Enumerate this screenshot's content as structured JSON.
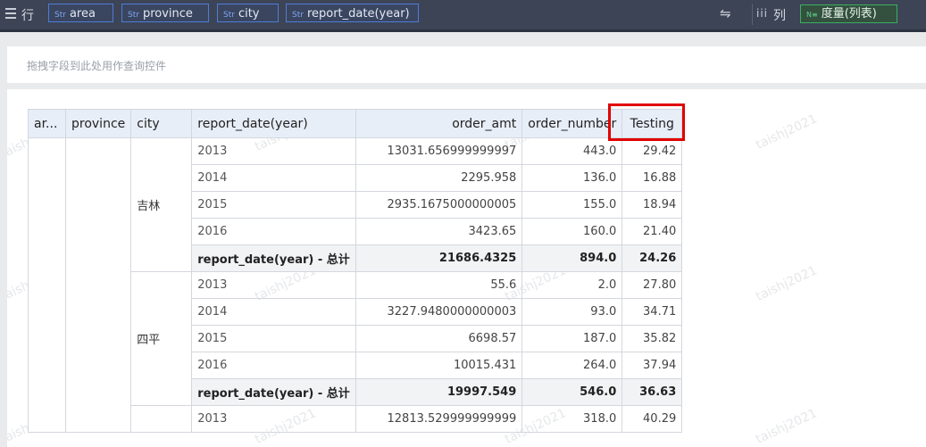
{
  "toolbar": {
    "rows_label": "行",
    "row_fields": [
      {
        "type": "Str",
        "name": "area"
      },
      {
        "type": "Str",
        "name": "province"
      },
      {
        "type": "Str",
        "name": "city"
      },
      {
        "type": "Str",
        "name": "report_date(year)"
      }
    ],
    "swap_icon": "⇋",
    "cols_icon": "iii",
    "cols_label": "列",
    "measure_field": {
      "type": "N≡",
      "name": "度量(列表)"
    }
  },
  "filter": {
    "placeholder": "拖拽字段到此处用作查询控件"
  },
  "watermark": "taishj2021",
  "table": {
    "headers": {
      "area": "ar...",
      "province": "province",
      "city": "city",
      "report_date": "report_date(year)",
      "order_amt": "order_amt",
      "order_number": "order_number",
      "testing": "Testing"
    },
    "groups": [
      {
        "city": "吉林",
        "rows": [
          {
            "year": "2013",
            "order_amt": "13031.656999999997",
            "order_number": "443.0",
            "testing": "29.42"
          },
          {
            "year": "2014",
            "order_amt": "2295.958",
            "order_number": "136.0",
            "testing": "16.88"
          },
          {
            "year": "2015",
            "order_amt": "2935.1675000000005",
            "order_number": "155.0",
            "testing": "18.94"
          },
          {
            "year": "2016",
            "order_amt": "3423.65",
            "order_number": "160.0",
            "testing": "21.40"
          }
        ],
        "subtotal": {
          "label": "report_date(year) - 总计",
          "order_amt": "21686.4325",
          "order_number": "894.0",
          "testing": "24.26"
        }
      },
      {
        "city": "四平",
        "rows": [
          {
            "year": "2013",
            "order_amt": "55.6",
            "order_number": "2.0",
            "testing": "27.80"
          },
          {
            "year": "2014",
            "order_amt": "3227.9480000000003",
            "order_number": "93.0",
            "testing": "34.71"
          },
          {
            "year": "2015",
            "order_amt": "6698.57",
            "order_number": "187.0",
            "testing": "35.82"
          },
          {
            "year": "2016",
            "order_amt": "10015.431",
            "order_number": "264.0",
            "testing": "37.94"
          }
        ],
        "subtotal": {
          "label": "report_date(year) - 总计",
          "order_amt": "19997.549",
          "order_number": "546.0",
          "testing": "36.63"
        }
      },
      {
        "city": "",
        "rows": [
          {
            "year": "2013",
            "order_amt": "12813.529999999999",
            "order_number": "318.0",
            "testing": "40.29"
          }
        ]
      }
    ]
  }
}
